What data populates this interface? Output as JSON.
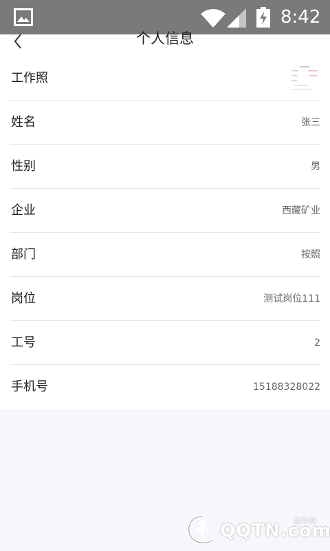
{
  "status_bar": {
    "time": "8:42",
    "icons": [
      "gallery-icon",
      "wifi-icon",
      "signal-icon",
      "battery-charging-icon"
    ]
  },
  "header": {
    "title": "个人信息",
    "back_icon": "chevron-left-icon"
  },
  "profile": {
    "rows": [
      {
        "label": "工作照",
        "type": "photo"
      },
      {
        "label": "姓名",
        "value": "张三"
      },
      {
        "label": "性别",
        "value": "男"
      },
      {
        "label": "企业",
        "value": "西藏矿业"
      },
      {
        "label": "部门",
        "value": "按照"
      },
      {
        "label": "岗位",
        "value": "测试岗位111"
      },
      {
        "label": "工号",
        "value": "2"
      },
      {
        "label": "手机号",
        "value": "15188328022"
      }
    ]
  },
  "watermark": {
    "site_small": "腾牛网",
    "site_big": "QQTN.com"
  },
  "colors": {
    "status_bar_bg": "#7a7a7a",
    "page_bg": "#f6f7fb",
    "list_bg": "#ffffff",
    "divider": "#e6e6e6"
  }
}
